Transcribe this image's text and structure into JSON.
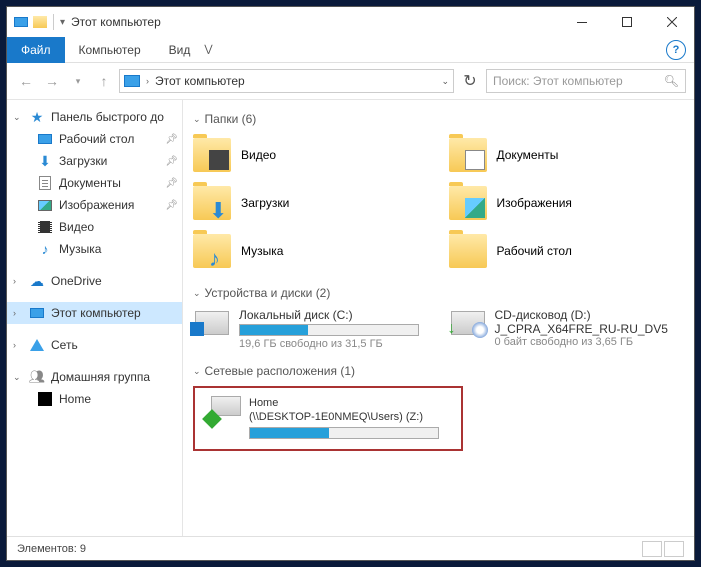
{
  "titlebar": {
    "title": "Этот компьютер"
  },
  "ribbon": {
    "file": "Файл",
    "tab1": "Компьютер",
    "tab2": "Вид"
  },
  "nav": {
    "address": "Этот компьютер",
    "search_placeholder": "Поиск: Этот компьютер"
  },
  "sidebar": {
    "quick_access": "Панель быстрого до",
    "desktop": "Рабочий стол",
    "downloads": "Загрузки",
    "documents": "Документы",
    "pictures": "Изображения",
    "video": "Видео",
    "music": "Музыка",
    "onedrive": "OneDrive",
    "this_pc": "Этот компьютер",
    "network": "Сеть",
    "homegroup": "Домашняя группа",
    "home": "Home"
  },
  "groups": {
    "folders": "Папки (6)",
    "drives": "Устройства и диски (2)",
    "network": "Сетевые расположения (1)"
  },
  "folders": {
    "video": "Видео",
    "documents": "Документы",
    "downloads": "Загрузки",
    "pictures": "Изображения",
    "music": "Музыка",
    "desktop": "Рабочий стол"
  },
  "drives": {
    "c": {
      "name": "Локальный диск (C:)",
      "free": "19,6 ГБ свободно из 31,5 ГБ",
      "fill_pct": 38
    },
    "d": {
      "name": "CD-дисковод (D:)",
      "label": "J_CPRA_X64FRE_RU-RU_DV5",
      "free": "0 байт свободно из 3,65 ГБ"
    }
  },
  "netloc": {
    "name": "Home",
    "path": "(\\\\DESKTOP-1E0NMEQ\\Users) (Z:)",
    "fill_pct": 42
  },
  "status": {
    "items": "Элементов: 9"
  }
}
